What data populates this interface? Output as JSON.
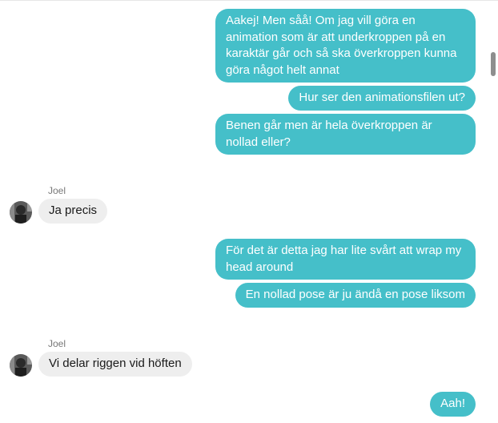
{
  "messages": [
    {
      "type": "outgoing",
      "text": "Aakej! Men såå! Om jag vill göra en animation som är att underkroppen på en karaktär går och så ska överkroppen kunna göra något helt annat"
    },
    {
      "type": "outgoing",
      "text": "Hur ser den animationsfilen ut?"
    },
    {
      "type": "outgoing",
      "text": "Benen går men är hela överkroppen är nollad eller?"
    },
    {
      "type": "incoming",
      "sender": "Joel",
      "text": "Ja precis"
    },
    {
      "type": "outgoing",
      "text": "För det är detta jag har lite svårt att wrap my head around"
    },
    {
      "type": "outgoing",
      "text": "En nollad pose är ju ändå en pose liksom"
    },
    {
      "type": "incoming",
      "sender": "Joel",
      "text": "Vi delar riggen vid höften"
    },
    {
      "type": "outgoing",
      "text": "Aah!"
    }
  ],
  "colors": {
    "outgoing_bubble": "#45bfc9",
    "incoming_bubble": "#eeeeee"
  },
  "icons": {
    "avatar": "user-avatar-photo"
  }
}
